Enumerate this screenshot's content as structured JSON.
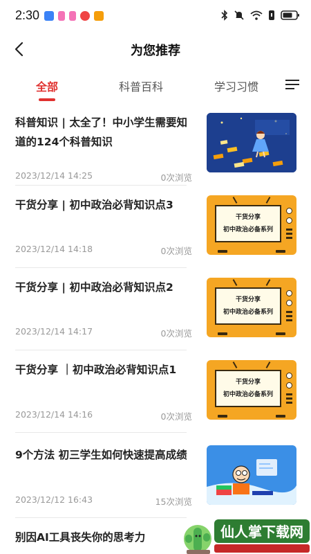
{
  "status_bar": {
    "time": "2:30",
    "app_icons": [
      "shield-app",
      "cube-app",
      "cube-app-2",
      "weibo-app",
      "note-app"
    ],
    "app_colors": [
      "#3b82f6",
      "#f472b6",
      "#f472b6",
      "#ef4444",
      "#f59e0b"
    ],
    "indicators": [
      "bluetooth-icon",
      "mute-icon",
      "wifi-icon",
      "sim-icon",
      "battery-icon"
    ]
  },
  "header": {
    "title": "为您推荐"
  },
  "tabs": [
    {
      "label": "全部",
      "active": true
    },
    {
      "label": "科普百科",
      "active": false
    },
    {
      "label": "学习习惯",
      "active": false
    }
  ],
  "articles": [
    {
      "title": "科普知识 | 太全了！中小学生需要知道的124个科普知识",
      "date": "2023/12/14 14:25",
      "views": "0次浏览",
      "thumb": "science-illustration"
    },
    {
      "title": "干货分享 | 初中政治必背知识点3",
      "date": "2023/12/14 14:18",
      "views": "0次浏览",
      "thumb": "tv-card",
      "thumb_line1": "干货分享",
      "thumb_line2": "初中政治必备系列"
    },
    {
      "title": "干货分享 | 初中政治必背知识点2",
      "date": "2023/12/14 14:17",
      "views": "0次浏览",
      "thumb": "tv-card",
      "thumb_line1": "干货分享",
      "thumb_line2": "初中政治必备系列"
    },
    {
      "title": "干货分享 ｜初中政治必背知识点1",
      "date": "2023/12/14 14:16",
      "views": "0次浏览",
      "thumb": "tv-card",
      "thumb_line1": "干货分享",
      "thumb_line2": "初中政治必备系列"
    },
    {
      "title": "9个方法 初三学生如何快速提高成绩",
      "date": "2023/12/12 16:43",
      "views": "15次浏览",
      "thumb": "study-cartoon"
    },
    {
      "title": "别因AI工具丧失你的思考力",
      "date": "",
      "views": "",
      "thumb": ""
    }
  ],
  "watermark": {
    "text": "仙人掌下载网"
  },
  "colors": {
    "accent": "#e0312f",
    "tv_orange": "#f5a623"
  }
}
